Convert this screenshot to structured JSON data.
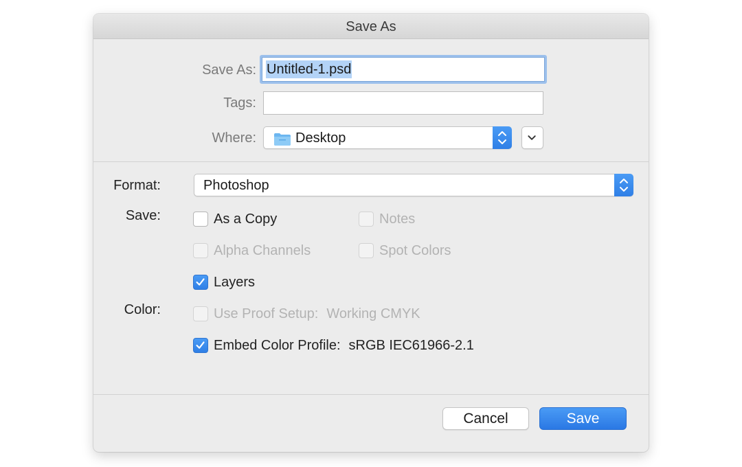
{
  "window": {
    "title": "Save As"
  },
  "file": {
    "save_as_label": "Save As:",
    "filename": "Untitled-1.psd",
    "tags_label": "Tags:",
    "tags_value": "",
    "where_label": "Where:",
    "where_value": "Desktop"
  },
  "options": {
    "format_label": "Format:",
    "format_value": "Photoshop",
    "save_label": "Save:",
    "color_label": "Color:",
    "as_a_copy": {
      "label": "As a Copy",
      "checked": false,
      "enabled": true
    },
    "notes": {
      "label": "Notes",
      "checked": false,
      "enabled": false
    },
    "alpha_channels": {
      "label": "Alpha Channels",
      "checked": false,
      "enabled": false
    },
    "spot_colors": {
      "label": "Spot Colors",
      "checked": false,
      "enabled": false
    },
    "layers": {
      "label": "Layers",
      "checked": true,
      "enabled": true
    },
    "use_proof_setup": {
      "label": "Use Proof Setup:",
      "value": "Working CMYK",
      "checked": false,
      "enabled": false
    },
    "embed_color_profile": {
      "label": "Embed Color Profile:",
      "value": "sRGB IEC61966-2.1",
      "checked": true,
      "enabled": true
    }
  },
  "buttons": {
    "cancel": "Cancel",
    "save": "Save"
  },
  "icons": {
    "folder": "folder-icon",
    "updown": "up-down-chevron-icon",
    "expand": "chevron-down-icon",
    "check": "checkmark-icon"
  },
  "colors": {
    "accent": "#2f7fe6",
    "dialog_bg": "#ececec",
    "selection": "#b3d3f7"
  }
}
